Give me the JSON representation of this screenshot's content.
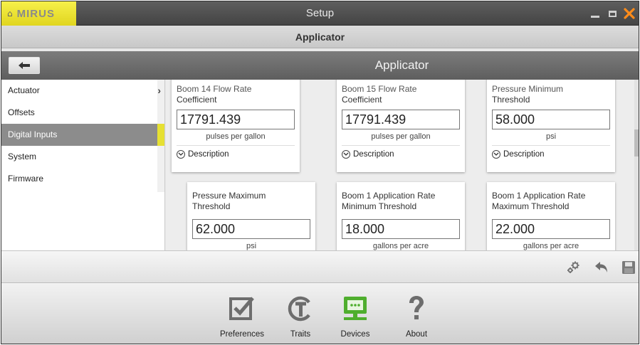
{
  "window": {
    "brand": "MIRUS",
    "title": "Setup",
    "controls": {
      "minimize": "minimize-icon",
      "maximize": "maximize-icon",
      "close": "close-icon"
    }
  },
  "header": {
    "title": "Applicator"
  },
  "nav": {
    "back_icon": "back-arrow-icon",
    "section_title": "Applicator"
  },
  "sidebar": {
    "items": [
      {
        "label": "Actuator"
      },
      {
        "label": "Offsets"
      },
      {
        "label": "Digital Inputs"
      },
      {
        "label": "System"
      },
      {
        "label": "Firmware"
      }
    ],
    "active_index": 2
  },
  "cards": [
    {
      "label_line1": "Boom 14 Flow Rate",
      "label_line2": "Coefficient",
      "value": "17791.439",
      "unit": "pulses per gallon",
      "description": "Description"
    },
    {
      "label_line1": "Boom 15 Flow Rate",
      "label_line2": "Coefficient",
      "value": "17791.439",
      "unit": "pulses per gallon",
      "description": "Description"
    },
    {
      "label_line1": "Pressure Minimum",
      "label_line2": "Threshold",
      "value": "58.000",
      "unit": "psi",
      "description": "Description"
    },
    {
      "label_line1": "Pressure Maximum",
      "label_line2": "Threshold",
      "value": "62.000",
      "unit": "psi"
    },
    {
      "label_line1": "Boom 1 Application Rate",
      "label_line2": "Minimum Threshold",
      "value": "18.000",
      "unit": "gallons per acre"
    },
    {
      "label_line1": "Boom 1 Application Rate",
      "label_line2": "Maximum Threshold",
      "value": "22.000",
      "unit": "gallons per acre"
    }
  ],
  "toolbar": {
    "icons": [
      "settings-gears-icon",
      "undo-icon",
      "save-icon"
    ]
  },
  "dock": {
    "items": [
      {
        "label": "Preferences",
        "icon": "checkbox-icon"
      },
      {
        "label": "Traits",
        "icon": "traits-t-icon"
      },
      {
        "label": "Devices",
        "icon": "devices-monitor-icon"
      },
      {
        "label": "About",
        "icon": "question-mark-icon"
      }
    ]
  },
  "colors": {
    "accent_yellow": "#e6e032",
    "devices_green": "#4fae2e",
    "close_orange": "#ff8c1a"
  }
}
